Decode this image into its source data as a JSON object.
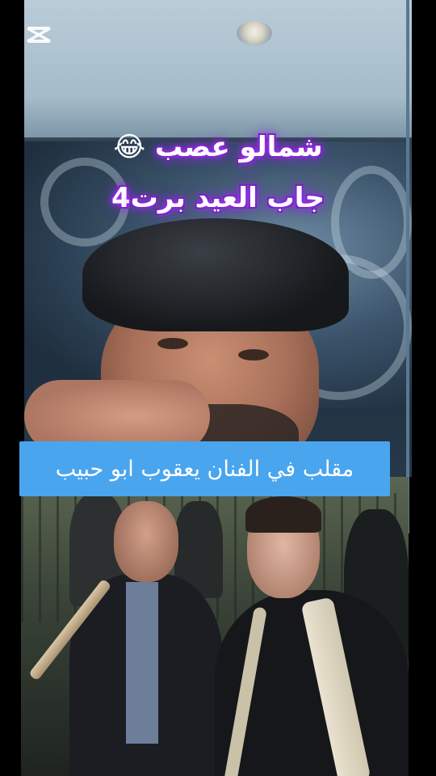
{
  "app": {
    "watermark_icon": "capcut-logo-icon"
  },
  "overlay": {
    "title_line_1": "شمالو عصب",
    "title_line_1_emoji": "😂",
    "title_line_2": "جاب  العيد برت4",
    "title_glow_color": "#8a2be2"
  },
  "caption": {
    "text": "مقلب في الفنان يعقوب ابو حبيب",
    "background_color": "#4aa5ef"
  }
}
